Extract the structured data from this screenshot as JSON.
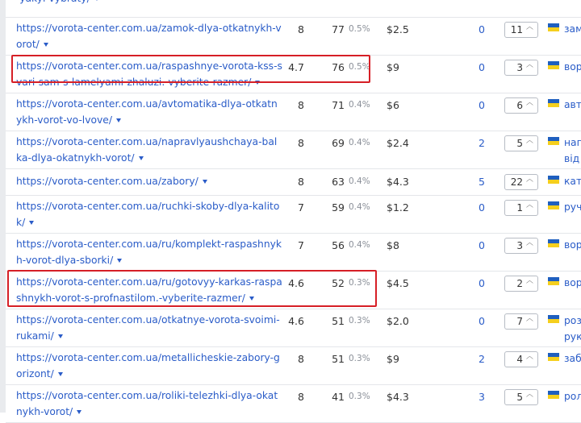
{
  "rows": [
    {
      "url": "-yakyi-vybraty/",
      "kd": "",
      "volume": "",
      "pct": "",
      "cpc": "",
      "count": "",
      "position": "",
      "keyword": ""
    },
    {
      "url": "https://vorota-center.com.ua/zamok-dlya-otkatnykh-vorot/",
      "kd": "8",
      "volume": "77",
      "pct": "0.5%",
      "cpc": "$2.5",
      "count": "0",
      "position": "11",
      "keyword": "зам"
    },
    {
      "url": "https://vorota-center.com.ua/raspashnye-vorota-kss-svari-sam-s-lamelyami-zhaluzi.-vyberite-razmer/",
      "kd": "4.7",
      "volume": "76",
      "pct": "0.5%",
      "cpc": "$9",
      "count": "0",
      "position": "3",
      "keyword": "вор"
    },
    {
      "url": "https://vorota-center.com.ua/avtomatika-dlya-otkatnykh-vorot-vo-lvove/",
      "kd": "8",
      "volume": "71",
      "pct": "0.4%",
      "cpc": "$6",
      "count": "0",
      "position": "6",
      "keyword": "авт"
    },
    {
      "url": "https://vorota-center.com.ua/napravlyaushchaya-balka-dlya-okatnykh-vorot/",
      "kd": "8",
      "volume": "69",
      "pct": "0.4%",
      "cpc": "$2.4",
      "count": "2",
      "position": "5",
      "keyword": "нап від"
    },
    {
      "url": "https://vorota-center.com.ua/zabory/",
      "kd": "8",
      "volume": "63",
      "pct": "0.4%",
      "cpc": "$4.3",
      "count": "5",
      "position": "22",
      "keyword": "кат"
    },
    {
      "url": "https://vorota-center.com.ua/ruchki-skoby-dlya-kalitok/",
      "kd": "7",
      "volume": "59",
      "pct": "0.4%",
      "cpc": "$1.2",
      "count": "0",
      "position": "1",
      "keyword": "руч"
    },
    {
      "url": "https://vorota-center.com.ua/ru/komplekt-raspashnykh-vorot-dlya-sborki/",
      "kd": "7",
      "volume": "56",
      "pct": "0.4%",
      "cpc": "$8",
      "count": "0",
      "position": "3",
      "keyword": "вор"
    },
    {
      "url": "https://vorota-center.com.ua/ru/gotovyy-karkas-raspashnykh-vorot-s-profnastilom.-vyberite-razmer/",
      "kd": "4.6",
      "volume": "52",
      "pct": "0.3%",
      "cpc": "$4.5",
      "count": "0",
      "position": "2",
      "keyword": "вор"
    },
    {
      "url": "https://vorota-center.com.ua/otkatnye-vorota-svoimi-rukami/",
      "kd": "4.6",
      "volume": "51",
      "pct": "0.3%",
      "cpc": "$2.0",
      "count": "0",
      "position": "7",
      "keyword": "роз рук"
    },
    {
      "url": "https://vorota-center.com.ua/metallicheskie-zabory-gorizont/",
      "kd": "8",
      "volume": "51",
      "pct": "0.3%",
      "cpc": "$9",
      "count": "2",
      "position": "4",
      "keyword": "заб"
    },
    {
      "url": "https://vorota-center.com.ua/roliki-telezhki-dlya-okatnykh-vorot/",
      "kd": "8",
      "volume": "41",
      "pct": "0.3%",
      "cpc": "$4.3",
      "count": "3",
      "position": "5",
      "keyword": "рол"
    }
  ]
}
